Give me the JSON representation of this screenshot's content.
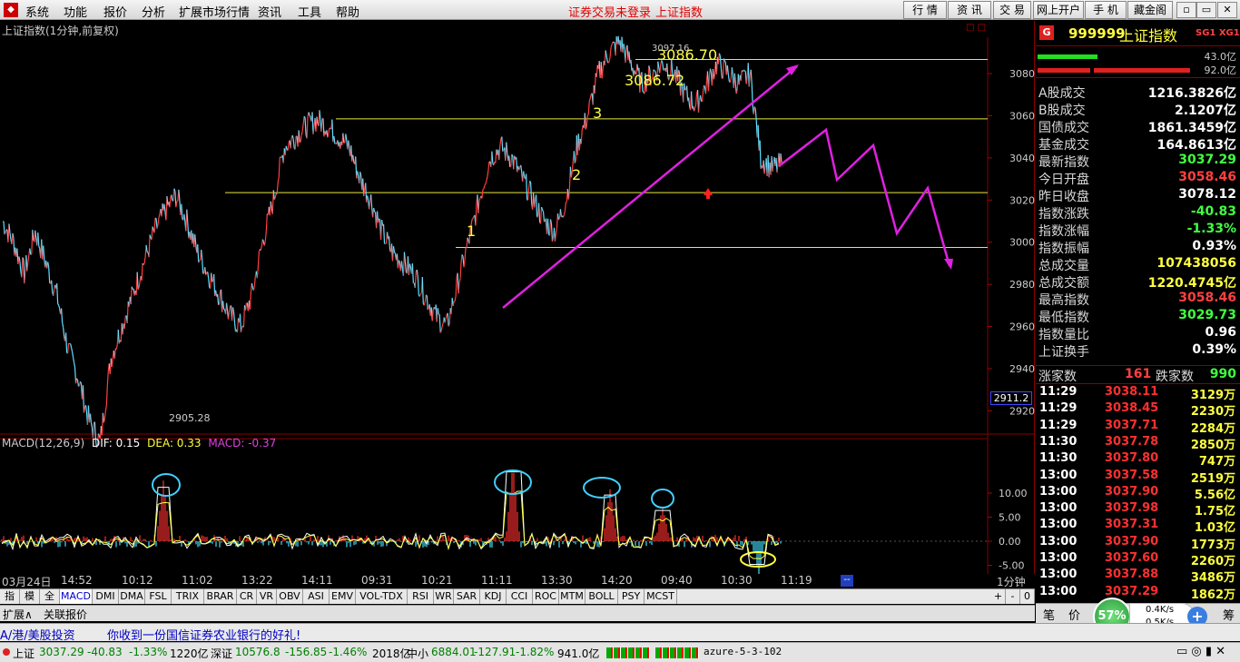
{
  "menu": [
    "系统",
    "功能",
    "报价",
    "分析",
    "扩展市场行情",
    "资讯",
    "工具",
    "帮助"
  ],
  "header": {
    "login_status": "证券交易未登录",
    "title": "上证指数"
  },
  "right_buttons": [
    "行 情",
    "资 讯",
    "交 易",
    "网上开户",
    "手 机",
    "藏金阁"
  ],
  "window_controls": [
    "▫",
    "▭",
    "✕"
  ],
  "chart": {
    "title": "上证指数(1分钟,前复权)",
    "y_ticks": [
      "3080",
      "3060",
      "3040",
      "3020",
      "3000",
      "2980",
      "2960",
      "2940",
      "2920"
    ],
    "current_box": "2911.2",
    "annotations": {
      "high": "3097.16",
      "level_a": "3086.70",
      "level_b": "3086.72",
      "low": "2905.28",
      "n1": "1",
      "n2": "2",
      "n3": "3"
    },
    "macd_title": "MACD(12,26,9)",
    "macd_dif": "DIF: 0.15",
    "macd_dea": "DEA: 0.33",
    "macd_val": "MACD: -0.37",
    "macd_ticks": [
      "10.00",
      "5.00",
      "0.00",
      "-5.00"
    ],
    "x_labels": [
      "03月24日",
      "14:52",
      "10:12",
      "11:02",
      "13:22",
      "14:11",
      "09:31",
      "10:21",
      "11:11",
      "13:30",
      "14:20",
      "09:40",
      "10:30",
      "11:19"
    ],
    "x_end": "1分钟"
  },
  "chart_data": {
    "type": "line",
    "title": "上证指数(1分钟,前复权)",
    "ylim": [
      2905,
      3098
    ],
    "series": [
      {
        "values": [
          3010,
          3000,
          2985,
          3005,
          2990,
          2975,
          2950,
          2935,
          2915,
          2905,
          2945,
          2960,
          2975,
          2990,
          3005,
          3015,
          3022,
          3010,
          2995,
          2985,
          2975,
          2965,
          2960,
          2975,
          3000,
          3020,
          3045,
          3050,
          3055,
          3058,
          3055,
          3050,
          3045,
          3030,
          3020,
          3005,
          2995,
          2990,
          2985,
          2975,
          2965,
          2960,
          2980,
          3000,
          3020,
          3040,
          3045,
          3040,
          3030,
          3020,
          3010,
          3005,
          3020,
          3045,
          3060,
          3080,
          3090,
          3095,
          3085,
          3075,
          3080,
          3085,
          3080,
          3070,
          3065,
          3075,
          3085,
          3080,
          3075,
          3080,
          3040,
          3035,
          3037
        ]
      }
    ],
    "horizontal_lines": [
      3086.7,
      3058.5,
      3023.5,
      2997.5
    ]
  },
  "side": {
    "code": "999999",
    "name": "上证指数",
    "tag": "SG1 XG1",
    "bar1": "43.0亿",
    "bar2": "92.0亿",
    "rows": [
      {
        "label": "A股成交",
        "value": "1216.3826亿",
        "color": "#ffffff"
      },
      {
        "label": "B股成交",
        "value": "2.1207亿",
        "color": "#ffffff"
      },
      {
        "label": "国债成交",
        "value": "1861.3459亿",
        "color": "#ffffff"
      },
      {
        "label": "基金成交",
        "value": "164.8613亿",
        "color": "#ffffff"
      },
      {
        "label": "最新指数",
        "value": "3037.29",
        "color": "#40ff40"
      },
      {
        "label": "今日开盘",
        "value": "3058.46",
        "color": "#ff4040"
      },
      {
        "label": "昨日收盘",
        "value": "3078.12",
        "color": "#ffffff"
      },
      {
        "label": "指数涨跌",
        "value": "-40.83",
        "color": "#40ff40"
      },
      {
        "label": "指数涨幅",
        "value": "-1.33%",
        "color": "#40ff40"
      },
      {
        "label": "指数振幅",
        "value": "0.93%",
        "color": "#ffffff"
      },
      {
        "label": "总成交量",
        "value": "107438056",
        "color": "#ffff40"
      },
      {
        "label": "总成交额",
        "value": "1220.4745亿",
        "color": "#ffff40"
      },
      {
        "label": "最高指数",
        "value": "3058.46",
        "color": "#ff4040"
      },
      {
        "label": "最低指数",
        "value": "3029.73",
        "color": "#40ff40"
      },
      {
        "label": "指数量比",
        "value": "0.96",
        "color": "#ffffff"
      },
      {
        "label": "上证换手",
        "value": "0.39%",
        "color": "#ffffff"
      }
    ],
    "up_label": "涨家数",
    "up_val": "161",
    "down_label": "跌家数",
    "down_val": "990",
    "ticks": [
      {
        "t": "11:29",
        "p": "3038.11",
        "v": "3129万"
      },
      {
        "t": "11:29",
        "p": "3038.45",
        "v": "2230万"
      },
      {
        "t": "11:29",
        "p": "3037.71",
        "v": "2284万"
      },
      {
        "t": "11:30",
        "p": "3037.78",
        "v": "2850万"
      },
      {
        "t": "11:30",
        "p": "3037.80",
        "v": "747万"
      },
      {
        "t": "13:00",
        "p": "3037.58",
        "v": "2519万"
      },
      {
        "t": "13:00",
        "p": "3037.90",
        "v": "5.56亿"
      },
      {
        "t": "13:00",
        "p": "3037.98",
        "v": "1.75亿"
      },
      {
        "t": "13:00",
        "p": "3037.31",
        "v": "1.03亿"
      },
      {
        "t": "13:00",
        "p": "3037.90",
        "v": "1773万"
      },
      {
        "t": "13:00",
        "p": "3037.60",
        "v": "2260万"
      },
      {
        "t": "13:00",
        "p": "3037.88",
        "v": "3486万"
      },
      {
        "t": "13:00",
        "p": "3037.29",
        "v": "1862万"
      }
    ],
    "bottom_tabs": [
      "笔",
      "价"
    ],
    "net_pct": "57%",
    "net_up": "0.4K/s",
    "net_down": "0.5K/s",
    "last_tab": "筹"
  },
  "tabs": [
    "指标",
    "模板",
    "全部",
    "MACD",
    "DMI",
    "DMA",
    "FSL",
    "TRIX",
    "BRAR",
    "CR",
    "VR",
    "OBV",
    "ASI",
    "EMV",
    "VOL-TDX",
    "RSI",
    "WR",
    "SAR",
    "KDJ",
    "CCI",
    "ROC",
    "MTM",
    "BOLL",
    "PSY",
    "MCST"
  ],
  "tab_right": [
    "+",
    "-",
    "0"
  ],
  "subtabs": [
    "扩展∧",
    "关联报价"
  ],
  "news": {
    "left": "A/港/美股投资",
    "msg": "你收到一份国信证券农业银行的好礼!"
  },
  "bottom": {
    "sh_label": "上证",
    "sh_val": "3037.29",
    "sh_chg": "-40.83",
    "sh_pct": "-1.33%",
    "sh_amt": "1220亿",
    "sz_label": "深证",
    "sz_val": "10576.8",
    "sz_chg": "-156.85",
    "sz_pct": "-1.46%",
    "sz_amt": "2018亿",
    "zx_label": "中小",
    "zx_val": "6884.01",
    "zx_chg": "-127.91",
    "zx_pct": "-1.82%",
    "zx_amt": "941.0亿",
    "server": "azure-5-3-102"
  }
}
